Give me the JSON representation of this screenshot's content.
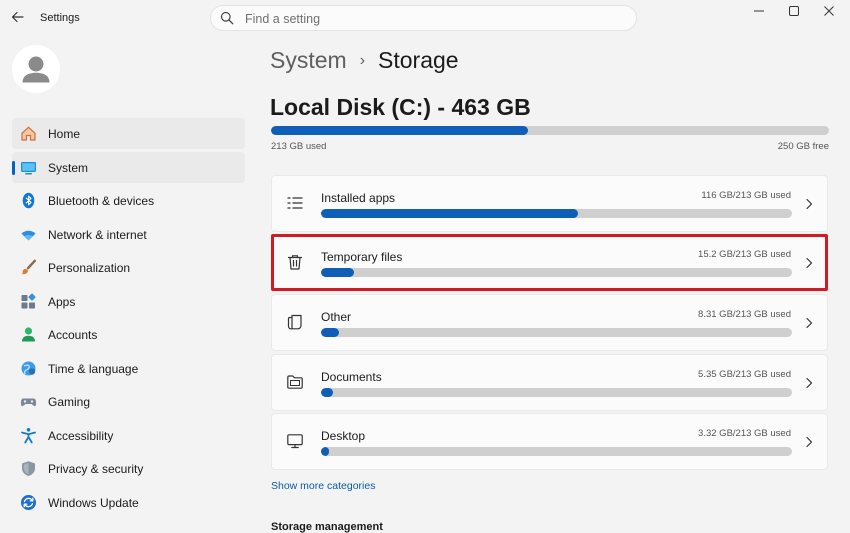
{
  "window": {
    "title": "Settings"
  },
  "search": {
    "placeholder": "Find a setting"
  },
  "colors": {
    "accent": "#0067c0",
    "bar_fill": "#0f5fb8",
    "bar_track": "#cfcfcf",
    "highlight_border": "#d01b24"
  },
  "sidebar": {
    "items": [
      {
        "label": "Home",
        "icon": "home-icon"
      },
      {
        "label": "System",
        "icon": "system-icon"
      },
      {
        "label": "Bluetooth & devices",
        "icon": "bluetooth-icon"
      },
      {
        "label": "Network & internet",
        "icon": "network-icon"
      },
      {
        "label": "Personalization",
        "icon": "brush-icon"
      },
      {
        "label": "Apps",
        "icon": "apps-icon"
      },
      {
        "label": "Accounts",
        "icon": "accounts-icon"
      },
      {
        "label": "Time & language",
        "icon": "globe-icon"
      },
      {
        "label": "Gaming",
        "icon": "gamepad-icon"
      },
      {
        "label": "Accessibility",
        "icon": "accessibility-icon"
      },
      {
        "label": "Privacy & security",
        "icon": "shield-icon"
      },
      {
        "label": "Windows Update",
        "icon": "update-icon"
      }
    ],
    "selected": "System"
  },
  "breadcrumb": {
    "parent": "System",
    "separator": "›",
    "current": "Storage"
  },
  "disk": {
    "title": "Local Disk (C:) - 463 GB",
    "used_label": "213 GB used",
    "free_label": "250 GB free",
    "used_fraction": 0.46
  },
  "categories": [
    {
      "name": "Installed apps",
      "size": "116 GB/213 GB used",
      "fraction": 0.545,
      "icon": "list-icon"
    },
    {
      "name": "Temporary files",
      "size": "15.2 GB/213 GB used",
      "fraction": 0.071,
      "icon": "trash-icon",
      "highlighted": true
    },
    {
      "name": "Other",
      "size": "8.31 GB/213 GB used",
      "fraction": 0.039,
      "icon": "other-files-icon"
    },
    {
      "name": "Documents",
      "size": "5.35 GB/213 GB used",
      "fraction": 0.025,
      "icon": "folder-icon"
    },
    {
      "name": "Desktop",
      "size": "3.32 GB/213 GB used",
      "fraction": 0.016,
      "icon": "monitor-icon"
    }
  ],
  "links": {
    "show_more": "Show more categories"
  },
  "sections": {
    "storage_management": "Storage management"
  }
}
